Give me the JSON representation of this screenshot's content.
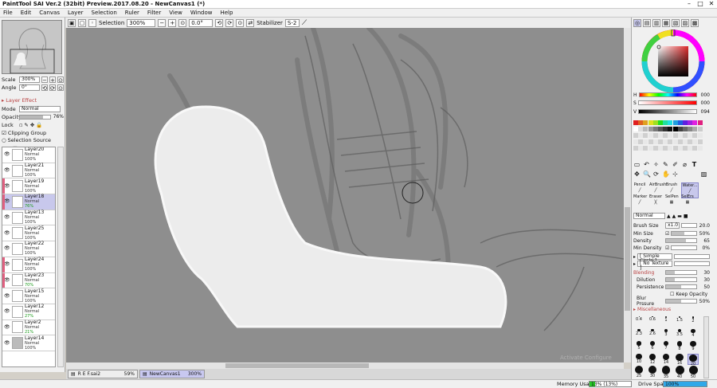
{
  "window": {
    "title": "PaintTool SAI Ver.2 (32bit) Preview.2017.08.20 - NewCanvas1 (*)"
  },
  "menu": [
    "File",
    "Edit",
    "Canvas",
    "Layer",
    "Selection",
    "Ruler",
    "Filter",
    "View",
    "Window",
    "Help"
  ],
  "toolbar": {
    "selection_label": "Selection",
    "zoom": "300%",
    "angle": "0.0°",
    "stabilizer_label": "Stabilizer",
    "stabilizer_value": "S-2"
  },
  "navigator": {
    "scale_label": "Scale",
    "scale_value": "300%",
    "angle_label": "Angle",
    "angle_value": "0°"
  },
  "layer_effect": {
    "header": "Layer Effect",
    "mode_label": "Mode",
    "mode_value": "Normal",
    "opacity_label": "Opacity",
    "opacity_value": "76%",
    "opacity_level": 76,
    "lock_label": "Lock",
    "clipping_group": "Clipping Group",
    "selection_source": "Selection Source"
  },
  "layers": [
    {
      "name": "Layer20",
      "mode": "Normal",
      "opacity": "100%"
    },
    {
      "name": "Layer21",
      "mode": "Normal",
      "opacity": "100%"
    },
    {
      "name": "Layer19",
      "mode": "Normal",
      "opacity": "100%"
    },
    {
      "name": "Layer18",
      "mode": "Normal",
      "opacity": "76%"
    },
    {
      "name": "Layer13",
      "mode": "Normal",
      "opacity": "100%"
    },
    {
      "name": "Layer25",
      "mode": "Normal",
      "opacity": "100%"
    },
    {
      "name": "Layer22",
      "mode": "Normal",
      "opacity": "100%"
    },
    {
      "name": "Layer24",
      "mode": "Normal",
      "opacity": "100%"
    },
    {
      "name": "Layer23",
      "mode": "Normal",
      "opacity": "70%"
    },
    {
      "name": "Layer15",
      "mode": "Normal",
      "opacity": "100%"
    },
    {
      "name": "Layer12",
      "mode": "Normal",
      "opacity": "27%"
    },
    {
      "name": "Layer2",
      "mode": "Normal",
      "opacity": "21%"
    },
    {
      "name": "Layer14",
      "mode": "Normal",
      "opacity": "100%"
    }
  ],
  "documents": [
    {
      "name": "R E F.sai2",
      "zoom": "59%"
    },
    {
      "name": "NewCanvas1",
      "zoom": "300%"
    }
  ],
  "watermark": "Activate Configure",
  "status": {
    "memory_label": "Memory Usage",
    "memory_value": "13% (13%)",
    "memory_level": 13,
    "drive_label": "Drive Space",
    "drive_value": "100%",
    "drive_level": 100
  },
  "color": {
    "h_label": "H",
    "h_value": "000",
    "s_label": "S",
    "s_value": "000",
    "v_label": "V",
    "v_value": "094",
    "current": "#f0f0f0",
    "ring_inner": "#dd2b2b"
  },
  "tools": {
    "pencil": "Pencil",
    "airbrush": "AirBrush",
    "brush": "Brush",
    "water": "Water...",
    "marker": "Marker",
    "eraser": "Eraser",
    "selpen": "SelPen",
    "selers": "SelErs"
  },
  "brush": {
    "mode": "Normal",
    "size_label": "Brush Size",
    "size_mult": "x1.0",
    "size_value": "20.0",
    "min_size_label": "Min Size",
    "min_size_value": "50%",
    "min_size_level": 50,
    "density_label": "Density",
    "density_value": "65",
    "density_level": 65,
    "min_density_label": "Min Density",
    "min_density_value": "0%",
    "min_density_level": 0,
    "shape": "[ Simple Circle ]",
    "texture": "[ No Texture ]",
    "blending_header": "Blending",
    "blending_value": "30",
    "blending_level": 30,
    "dilution_label": "Dilution",
    "dilution_value": "30",
    "dilution_level": 30,
    "persistence_label": "Persistence",
    "persistence_value": "50",
    "persistence_level": 50,
    "keep_opacity": "Keep Opacity",
    "blur_label": "Blur Prssure",
    "blur_value": "50%",
    "blur_level": 50,
    "misc_header": "Miscellaneous"
  },
  "sizes": [
    "0.4",
    "0.6",
    "1",
    "1.5",
    "2",
    "2.3",
    "2.6",
    "3",
    "3.5",
    "4",
    "5",
    "6",
    "7",
    "8",
    "9",
    "10",
    "12",
    "14",
    "16",
    "20",
    "25",
    "30",
    "35",
    "40",
    "50"
  ]
}
